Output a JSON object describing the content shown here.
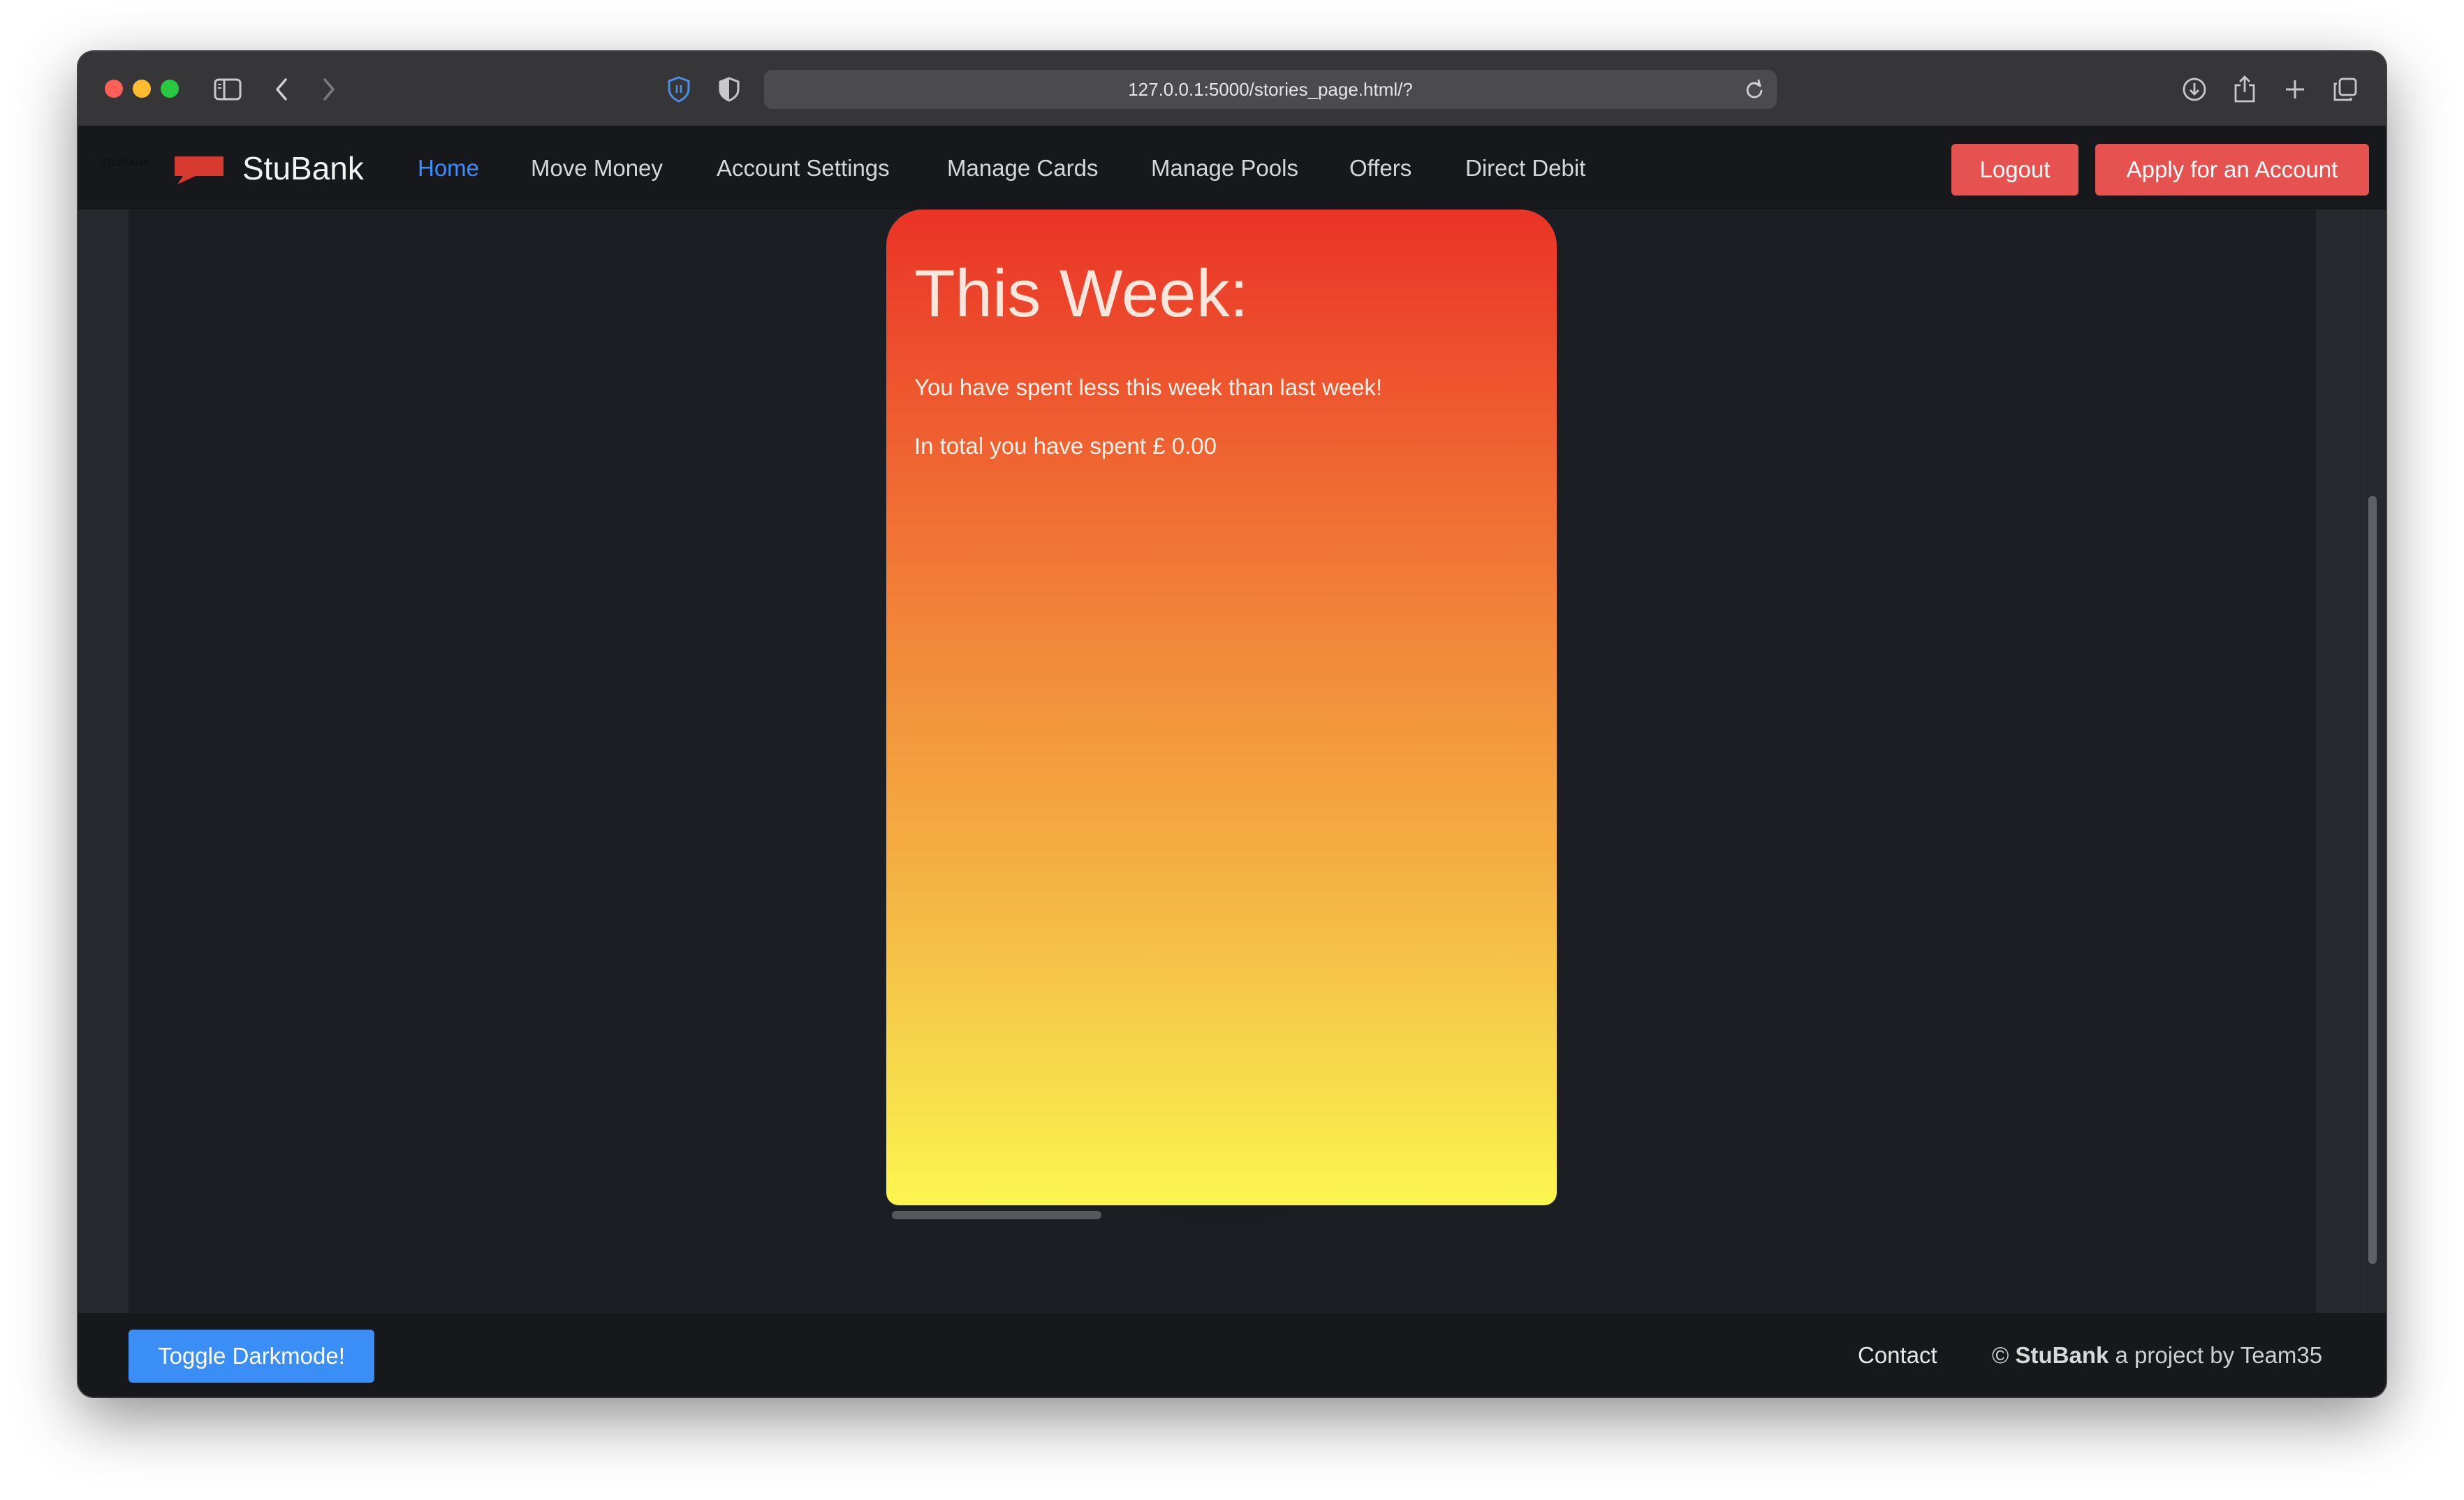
{
  "browser": {
    "url": "127.0.0.1:5000/stories_page.html/?"
  },
  "navbar": {
    "brand_name": "StuBank",
    "links": [
      "Home",
      "Move Money",
      "Account Settings",
      "Manage Cards",
      "Manage Pools",
      "Offers",
      "Direct Debit"
    ],
    "active_link": "Home",
    "logout_label": "Logout",
    "apply_label": "Apply for an Account"
  },
  "story": {
    "title": "This Week:",
    "line1": "You have spent less this week than last week!",
    "line2": "In total you have spent £ 0.00",
    "gradient_colors": [
      "#ea3326",
      "#fbf64f"
    ]
  },
  "footer": {
    "toggle_label": "Toggle Darkmode!",
    "contact_label": "Contact",
    "copyright_symbol": "©",
    "brand": "StuBank",
    "tagline": "a project by Team35"
  },
  "colors": {
    "accent_blue": "#3d8bfd",
    "button_red": "#e5524f",
    "button_blue": "#3b8ef5",
    "background": "#1b1e22"
  }
}
